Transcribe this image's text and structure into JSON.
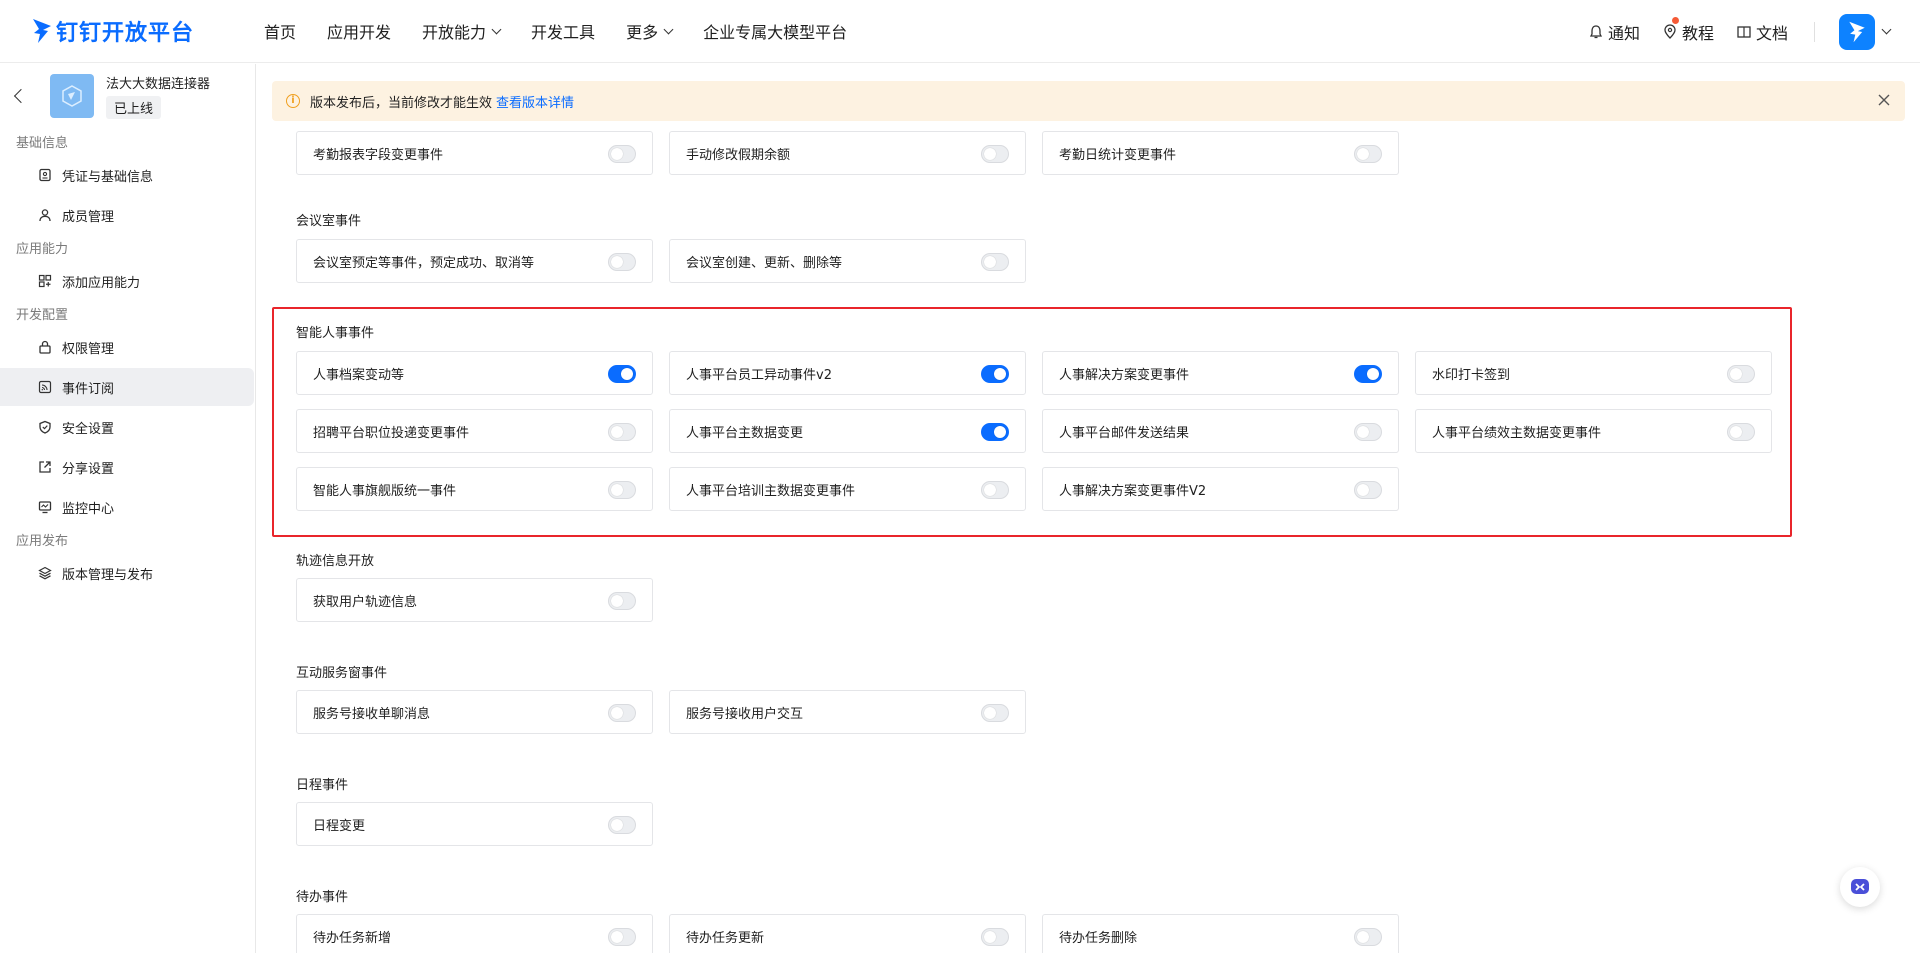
{
  "topnav": {
    "logo_text": "钉钉开放平台",
    "items": [
      {
        "label": "首页",
        "has_dropdown": false
      },
      {
        "label": "应用开发",
        "has_dropdown": false
      },
      {
        "label": "开放能力",
        "has_dropdown": true
      },
      {
        "label": "开发工具",
        "has_dropdown": false
      },
      {
        "label": "更多",
        "has_dropdown": true
      },
      {
        "label": "企业专属大模型平台",
        "has_dropdown": false
      }
    ],
    "right": {
      "notify": "通知",
      "tutorial": "教程",
      "docs": "文档"
    }
  },
  "sidebar": {
    "app_name": "法大大数据连接器",
    "app_status": "已上线",
    "groups": [
      {
        "title": "基础信息",
        "items": [
          {
            "label": "凭证与基础信息",
            "icon": "credential-icon"
          },
          {
            "label": "成员管理",
            "icon": "user-icon"
          }
        ]
      },
      {
        "title": "应用能力",
        "items": [
          {
            "label": "添加应用能力",
            "icon": "apps-add-icon"
          }
        ]
      },
      {
        "title": "开发配置",
        "items": [
          {
            "label": "权限管理",
            "icon": "lock-icon"
          },
          {
            "label": "事件订阅",
            "icon": "rss-icon",
            "active": true
          },
          {
            "label": "安全设置",
            "icon": "shield-icon"
          },
          {
            "label": "分享设置",
            "icon": "share-icon"
          },
          {
            "label": "监控中心",
            "icon": "monitor-icon"
          }
        ]
      },
      {
        "title": "应用发布",
        "items": [
          {
            "label": "版本管理与发布",
            "icon": "layers-icon"
          }
        ]
      }
    ]
  },
  "banner": {
    "text": "版本发布后，当前修改才能生效",
    "link": "查看版本详情"
  },
  "sections": {
    "attendance": {
      "cards": [
        {
          "label": "考勤报表字段变更事件",
          "on": false
        },
        {
          "label": "手动修改假期余额",
          "on": false
        },
        {
          "label": "考勤日统计变更事件",
          "on": false
        }
      ]
    },
    "meeting_room": {
      "title": "会议室事件",
      "cards": [
        {
          "label": "会议室预定等事件，预定成功、取消等",
          "on": false
        },
        {
          "label": "会议室创建、更新、删除等",
          "on": false
        }
      ]
    },
    "smart_hr": {
      "title": "智能人事事件",
      "cards": [
        {
          "label": "人事档案变动等",
          "on": true
        },
        {
          "label": "人事平台员工异动事件v2",
          "on": true
        },
        {
          "label": "人事解决方案变更事件",
          "on": true
        },
        {
          "label": "水印打卡签到",
          "on": false
        },
        {
          "label": "招聘平台职位投递变更事件",
          "on": false
        },
        {
          "label": "人事平台主数据变更",
          "on": true
        },
        {
          "label": "人事平台邮件发送结果",
          "on": false
        },
        {
          "label": "人事平台绩效主数据变更事件",
          "on": false
        },
        {
          "label": "智能人事旗舰版统一事件",
          "on": false
        },
        {
          "label": "人事平台培训主数据变更事件",
          "on": false
        },
        {
          "label": "人事解决方案变更事件V2",
          "on": false
        }
      ]
    },
    "track": {
      "title": "轨迹信息开放",
      "cards": [
        {
          "label": "获取用户轨迹信息",
          "on": false
        }
      ]
    },
    "service_window": {
      "title": "互动服务窗事件",
      "cards": [
        {
          "label": "服务号接收单聊消息",
          "on": false
        },
        {
          "label": "服务号接收用户交互",
          "on": false
        }
      ]
    },
    "schedule": {
      "title": "日程事件",
      "cards": [
        {
          "label": "日程变更",
          "on": false
        }
      ]
    },
    "todo": {
      "title": "待办事件",
      "cards": [
        {
          "label": "待办任务新增",
          "on": false
        },
        {
          "label": "待办任务更新",
          "on": false
        },
        {
          "label": "待办任务删除",
          "on": false
        }
      ]
    }
  },
  "colors": {
    "brand": "#0a6cff",
    "highlight_border": "#e9252b",
    "banner_bg": "#fdf2e1"
  }
}
